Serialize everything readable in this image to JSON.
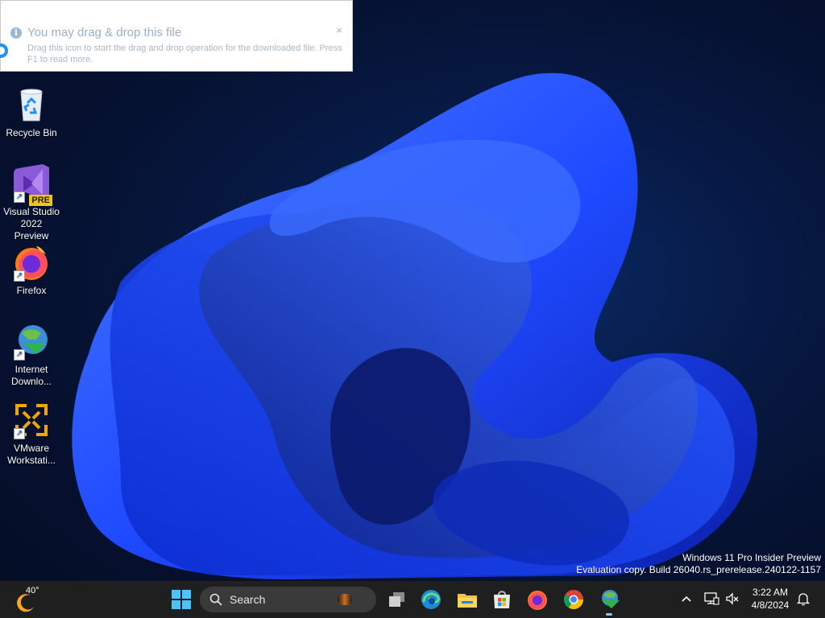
{
  "notification": {
    "title": "You may drag & drop this file",
    "body": "Drag this icon to start the drag and drop operation for the downloaded file. Press F1 to read more.",
    "close": "×"
  },
  "desktop": {
    "recycle_bin": "Recycle Bin",
    "vs_line1": "Visual Studio",
    "vs_line2": "2022 Preview",
    "vs_badge": "PRE",
    "firefox": "Firefox",
    "idm_line1": "Internet",
    "idm_line2": "Downlo...",
    "vmware_line1": "VMware",
    "vmware_line2": "Workstati..."
  },
  "watermark": {
    "line1": "Windows 11 Pro Insider Preview",
    "line2": "Evaluation copy. Build 26040.rs_prerelease.240122-1157"
  },
  "taskbar": {
    "weather_temp": "40°",
    "search_label": "Search",
    "time": "3:22 AM",
    "date": "4/8/2024"
  },
  "colors": {
    "taskbar_bg": "#1f1f1f",
    "accent": "#3aa0ff"
  }
}
